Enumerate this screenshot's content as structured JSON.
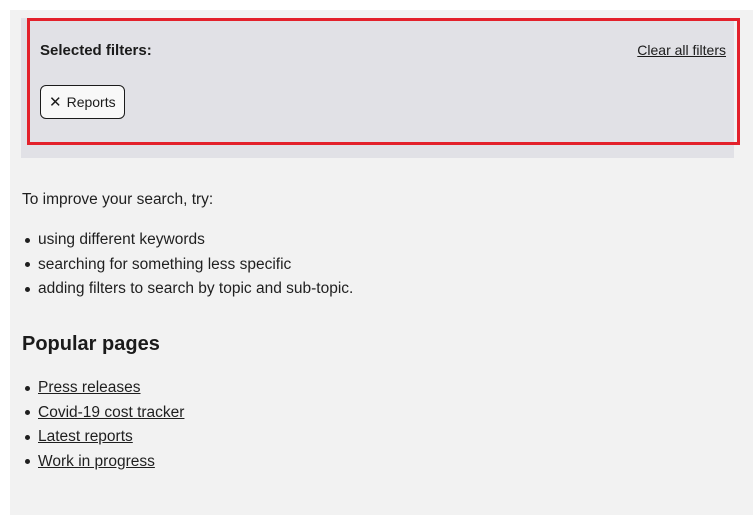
{
  "filters": {
    "heading": "Selected filters:",
    "clear_all": "Clear all filters",
    "chips": [
      {
        "label": "Reports",
        "icon": "close-icon"
      }
    ]
  },
  "search_help": {
    "intro": "To improve your search, try:",
    "tips": [
      "using different keywords",
      "searching for something less specific",
      "adding filters to search by topic and sub-topic."
    ]
  },
  "popular": {
    "heading": "Popular pages",
    "links": [
      "Press releases",
      "Covid-19 cost tracker",
      "Latest reports",
      "Work in progress"
    ]
  },
  "colors": {
    "highlight": "#e3212b",
    "panel": "#f2f2f2",
    "filters_bg": "#e1e1e6"
  }
}
